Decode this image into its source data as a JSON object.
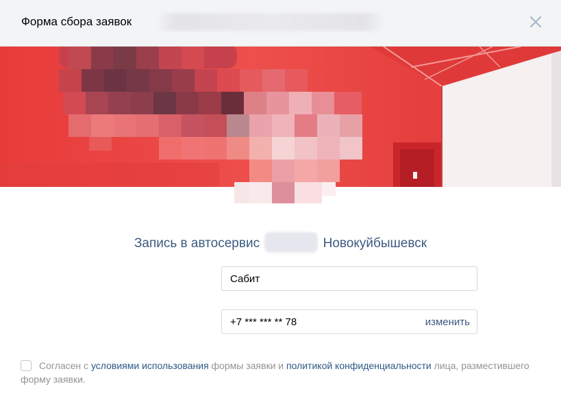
{
  "header": {
    "title": "Форма сбора заявок",
    "close_icon": "close-icon"
  },
  "form": {
    "title_before": "Запись в автосервис",
    "title_after": "Новокуйбышевск",
    "name_value": "Сабит",
    "phone_value": "+7 *** *** ** 78",
    "change_label": "изменить"
  },
  "consent": {
    "t1": "Согласен с ",
    "link1": "условиями использования",
    "t2": " формы заявки и ",
    "link2": "политикой конфиденциальности",
    "t3": " лица, разместившего форму заявки."
  },
  "colors": {
    "header_bg": "#f2f4f6",
    "link": "#2a5885",
    "title": "#3c5a80",
    "cover_red": "#e8403f"
  }
}
